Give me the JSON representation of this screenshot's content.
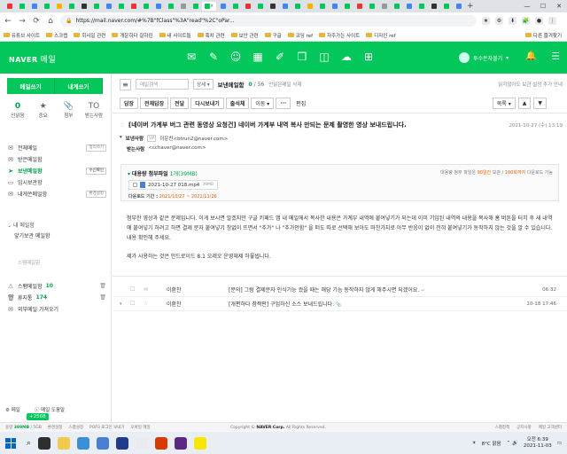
{
  "browser": {
    "tab_count": 42,
    "active_tab_close": "×",
    "new_tab": "+",
    "window_buttons": [
      "—",
      "☐",
      "✕"
    ],
    "url": "https://mail.naver.com/#%7B\"fClass\"%3A\"read\"%2C\"oPar...",
    "nav": {
      "back": "←",
      "forward": "→",
      "reload": "⟳",
      "home": "⌂"
    },
    "bookmarks": [
      "유튜브 사이트",
      "스크랩",
      "회사일 관련",
      "개운하다 잘하린",
      "내 사이트들",
      "혹차 관련",
      "보안 관련",
      "구글",
      "코딩 ref",
      "자주가는 사이트",
      "디자인 ref"
    ],
    "other_bookmarks": "다른 즐겨찾기"
  },
  "gnb": {
    "logo": "NAVER",
    "service": "메일",
    "user": "투수돈자블기",
    "user_chevron": "▾",
    "icons": [
      "mail-icon",
      "write-icon",
      "contacts-icon",
      "calendar-icon",
      "memo-icon",
      "box-icon",
      "drive-icon",
      "cloud-icon",
      "grid-icon"
    ],
    "bell": "🔔",
    "menu": "☰"
  },
  "sidebar": {
    "write_button": "메일쓰기",
    "self_write_button": "내게쓰기",
    "quick": [
      {
        "value": "0",
        "label": "안읽음"
      },
      {
        "icon": "★",
        "label": "중요"
      },
      {
        "icon": "📎",
        "label": "첨부"
      },
      {
        "icon": "TO",
        "label": "받는사람"
      }
    ],
    "folders": [
      {
        "icon": "✉",
        "label": "전체메일",
        "tag": "정리하기"
      },
      {
        "icon": "✉",
        "label": "받은메일함",
        "tag": ""
      },
      {
        "icon": "➤",
        "label": "보낸메일함",
        "tag": "수신확인",
        "selected": true
      },
      {
        "icon": "▭",
        "label": "임시보관함",
        "tag": ""
      },
      {
        "icon": "✉",
        "label": "내게쓴메일함",
        "tag": "환경설정"
      }
    ],
    "group_header": "내 메일함",
    "group_item": "앞기보관 메일함",
    "spam_link": "스팸메일함",
    "system_folders": [
      {
        "icon": "⚠",
        "label": "스팸메일함",
        "count": "10"
      },
      {
        "icon": "🗑",
        "label": "휴지통",
        "count": "174"
      },
      {
        "icon": "✉",
        "label": "외부메일 가져오기",
        "count": ""
      }
    ],
    "bottom_links": [
      "메일",
      "메일 도움말"
    ],
    "badge": "+2568"
  },
  "toolbar": {
    "hamburger": "≡",
    "search_placeholder": "메일검색",
    "search_scope": "상세 ▾",
    "folder_name": "보낸메일함",
    "read_count": "0",
    "total_count": "56",
    "unread_info": "안읽은메일 삭제",
    "right_info": "읽지않아도 보관 설정 추가 안내",
    "reply": "답장",
    "reply_all": "전체답장",
    "forward": "전달",
    "resend": "다시보내기",
    "print": "출석체",
    "move": "이동 ▾",
    "more": "···",
    "edit": "편집",
    "sort": "목록 ▾",
    "prev": "▲",
    "next": "▼"
  },
  "mail": {
    "subject": "[네이버 가계부 버그 관련 동영상 요청건] 네이버 가계부 내역 복사 만되는 문제 촬영한 영상 보내드립니다.",
    "date": "2021-10-27 (수) 13:19",
    "sender_label": "보낸사람",
    "sender_vip": "VIP",
    "sender": "이운찬<btrun2@naver.com>",
    "recipient_label": "받는사람",
    "recipient": "<cchaver@naver.com>",
    "attach_title": "대용량 첨부파일",
    "attach_count": "1개(39MB)",
    "attach_note_pre": "대용량 첨부 파일은",
    "attach_note_days": "90일간",
    "attach_note_mid": "보관 /",
    "attach_note_limit": "100회까지",
    "attach_note_post": "다운로드 가능",
    "file_name": "2021-10-27 018.mp4",
    "file_size": "39MB",
    "period_label": "다운로드 기간 :",
    "period": "2021/10/27 ~ 2021/11/26",
    "body_p1": "첨부한 영상과 같은 문제입니다. 이게 보시면 알겠지만 구글 키패드 앱 내 메일에서 복사한 내용은 가계부 내역에 붙여넣기가 되는데 이미 기입된 내역의 내용을 복사해 홈 버튼을 터치 후 새 내역에 붙여넣기 하려고 하면 결제 문자 붙여넣기 창없이 뜨면서 \"추가\" 나 \"추가안함\" 을 떠도 따로 선택해 보아도 마찬가지로 아무 반응이 없이 전혀 붙여넣기가 동작하지 않는 것을 알 수 있습니다. 내용 확인해 주세요.",
    "body_p2": "제가 사용하는 것은 안드로이드 8.1 오레오 운영체제 하뭏씹니다."
  },
  "list": [
    {
      "sender": "이환찬",
      "chip": "[문의]",
      "subject": "그럼 결제문자 인식기능 켰을 때는 해당 기능 동작하지 않게 해주시면 되겠어요.",
      "time": "06:32"
    },
    {
      "sender": "이환찬",
      "chip": "",
      "subject": "[개편하다 참짝판] 구입하신 소스 보내드립니다.",
      "time": "10-18 17:46"
    }
  ],
  "footer": {
    "usage_label": "용량",
    "usage": "389MB",
    "quota": "/ 5GB",
    "links": [
      "환경설정",
      "스팸설정",
      "POP3 로그인 보내기",
      "모바일 메일"
    ],
    "copyright_pre": "Copyright ©",
    "copyright_brand": "NAVER Corp.",
    "copyright_post": "All Rights Reserved.",
    "right_links": [
      "스팸정책",
      "공지사항",
      "메일 고객센터"
    ]
  },
  "taskbar": {
    "weather": "8°C 맑음",
    "time": "오전 6:39",
    "date": "2021-11-03",
    "search_icon": "⌕"
  }
}
